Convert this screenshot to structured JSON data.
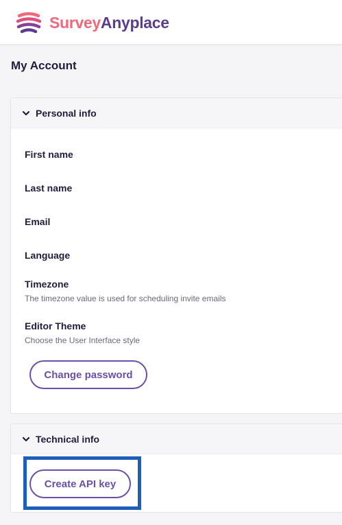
{
  "brand": {
    "word1": "Survey",
    "word2": "Anyplace"
  },
  "page_title": "My Account",
  "personal": {
    "header": "Personal info",
    "fields": {
      "first_name": "First name",
      "last_name": "Last name",
      "email": "Email",
      "language": "Language",
      "timezone": "Timezone",
      "timezone_help": "The timezone value is used for scheduling invite emails",
      "editor_theme": "Editor Theme",
      "editor_theme_help": "Choose the User Interface style"
    },
    "change_password": "Change password"
  },
  "technical": {
    "header": "Technical info",
    "create_api_key": "Create API key"
  },
  "colors": {
    "brand_coral": "#f0697a",
    "brand_purple": "#5a3d8f",
    "button_purple": "#6b4fa8",
    "highlight_blue": "#1e5ebd"
  }
}
